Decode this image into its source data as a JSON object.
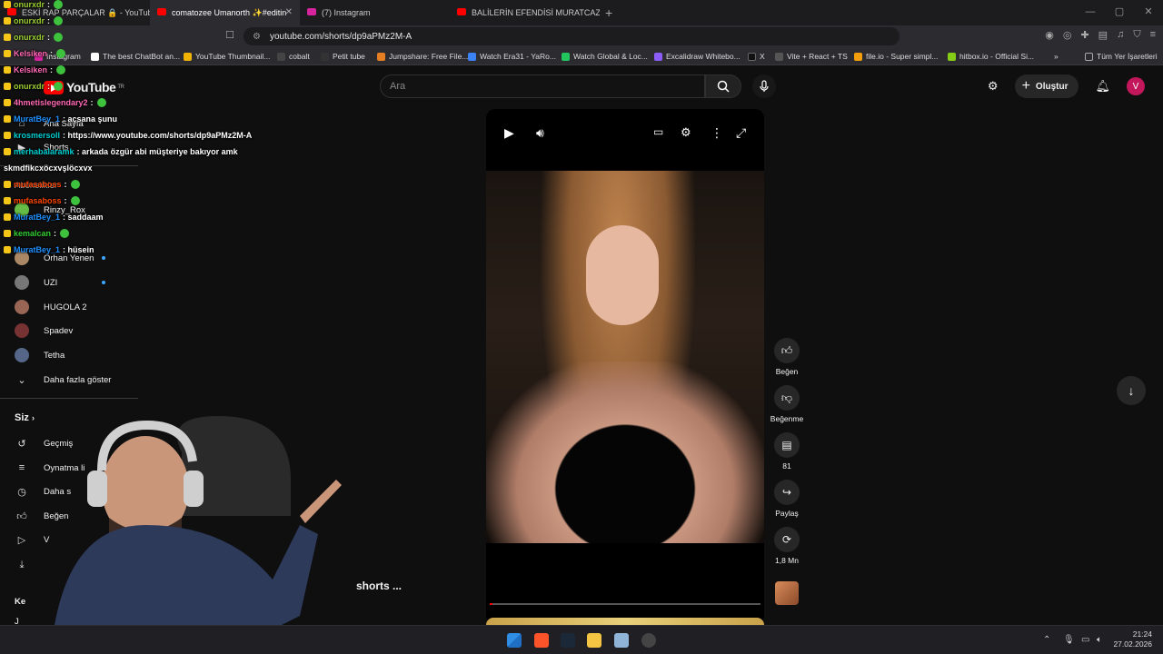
{
  "browser": {
    "tabs": [
      {
        "title": "ESKİ RAP PARÇALAR 🔒 - YouTube",
        "active": false
      },
      {
        "title": "comatozee Umanorth ✨#editin",
        "active": true
      },
      {
        "title": "(7) Instagram",
        "active": false
      },
      {
        "title": "BALİLERİN EFENDİSİ MURATCAZ'IN",
        "active": false
      }
    ],
    "url": "youtube.com/shorts/dp9aPMz2M-A",
    "bookmarks": [
      "Instagram",
      "The best ChatBot an...",
      "YouTube Thumbnail...",
      "cobalt",
      "Petit tube",
      "Jumpshare: Free File...",
      "Watch Era31 - YaRo...",
      "Watch Global & Loc...",
      "Excalidraw Whitebo...",
      "X",
      "Vite + React + TS",
      "file.io - Super simpl...",
      "hitbox.io - Official Si..."
    ],
    "all_bookmarks": "Tüm Yer İşaretleri"
  },
  "youtube": {
    "logo": "YouTube",
    "logo_sup": "TR",
    "search_placeholder": "Ara",
    "create_label": "Oluştur",
    "avatar_letter": "V",
    "sidebar": {
      "home": "Ana Sayfa",
      "shorts": "Shorts",
      "subscriptions": "Abonelikler",
      "channels": [
        {
          "name": "Rinzy_Rox",
          "dot": false
        },
        {
          "name": "Orhan Yenen",
          "dot": true
        },
        {
          "name": "UZI",
          "dot": true
        },
        {
          "name": "HUGOLA 2",
          "dot": false
        },
        {
          "name": "Spadev",
          "dot": false
        },
        {
          "name": "Tetha",
          "dot": false
        }
      ],
      "show_more": "Daha fazla göster",
      "you": "Siz",
      "history": "Geçmiş",
      "playlists": "Oynatma li",
      "watch_later": "Daha s",
      "liked": "Beğen",
      "your_videos": "V",
      "explore": "Ke",
      "explore2": "J"
    },
    "actions": {
      "like": "Beğen",
      "dislike": "Beğenme",
      "comments": "81",
      "share": "Paylaş",
      "remix": "1,8 Mn"
    },
    "overlay_title": "shorts ...",
    "progress_fraction": 0.01
  },
  "chat": [
    {
      "user": "onurxdr",
      "text": ":",
      "color": "#9acd32",
      "emote": true
    },
    {
      "user": "onurxdr",
      "text": ":",
      "color": "#9acd32",
      "emote": true
    },
    {
      "user": "onurxdr",
      "text": ":",
      "color": "#9acd32",
      "emote": true
    },
    {
      "user": "Kelsiken",
      "text": ":",
      "color": "#ff69b4",
      "emote": true
    },
    {
      "user": "Kelsiken",
      "text": ":",
      "color": "#ff69b4",
      "emote": true
    },
    {
      "user": "onurxdr",
      "text": ":",
      "color": "#9acd32",
      "emote": true
    },
    {
      "user": "4hmetislegendary2",
      "text": ":",
      "color": "#ff69b4",
      "emote": true
    },
    {
      "user": "MuratBey_1",
      "text": ": açsana şunu",
      "color": "#1e90ff",
      "emote": false
    },
    {
      "user": "krosmersoll",
      "text": ": https://www.youtube.com/shorts/dp9aPMz2M-A",
      "color": "#00ced1",
      "emote": false
    },
    {
      "user": "merhabalaramk",
      "text": ": arkada özgür abi müşteriye bakıyor amk",
      "color": "#00ced1",
      "emote": false
    },
    {
      "user": "",
      "text": "skmdfikcxöcxvşlöcxvx",
      "color": "#ffffff",
      "emote": false
    },
    {
      "user": "mufasaboss",
      "text": ":",
      "color": "#ff4500",
      "emote": true
    },
    {
      "user": "mufasaboss",
      "text": ":",
      "color": "#ff4500",
      "emote": true
    },
    {
      "user": "MuratBey_1",
      "text": ": saddaam",
      "color": "#1e90ff",
      "emote": false
    },
    {
      "user": "kemalcan",
      "text": ":",
      "color": "#32cd32",
      "emote": true
    },
    {
      "user": "MuratBey_1",
      "text": ": hüsein",
      "color": "#1e90ff",
      "emote": false
    }
  ],
  "taskbar": {
    "time": "21:24",
    "date": "27.02.2026"
  }
}
